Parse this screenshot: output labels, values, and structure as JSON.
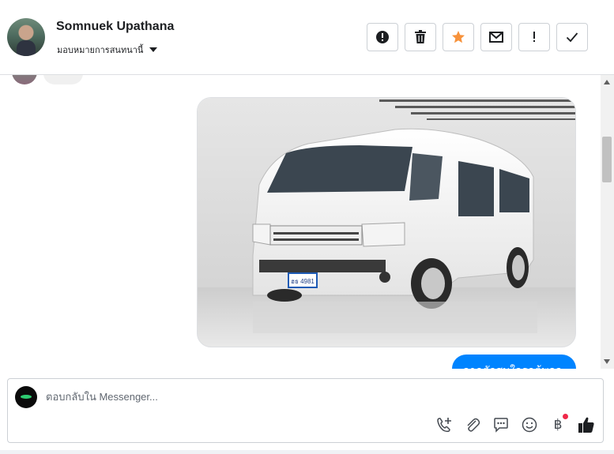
{
  "header": {
    "contact_name": "Somnuek Upathana",
    "assign_label": "มอบหมายการสนทนานี้",
    "toolbar": [
      {
        "name": "mark-spam-button",
        "icon": "alert-circle-icon"
      },
      {
        "name": "delete-button",
        "icon": "trash-icon"
      },
      {
        "name": "star-button",
        "icon": "star-icon",
        "color": "#f7923b"
      },
      {
        "name": "mark-unread-button",
        "icon": "envelope-icon"
      },
      {
        "name": "follow-up-button",
        "icon": "exclamation-icon"
      },
      {
        "name": "mark-done-button",
        "icon": "checkmark-icon"
      }
    ]
  },
  "messages": {
    "sent_image": {
      "subject": "white-toyota-van",
      "plate": "ฮธ 4981"
    },
    "sent_text": "จากตัวสมใจรถตู้พอจะ"
  },
  "composer": {
    "placeholder": "ตอบกลับใน Messenger...",
    "value": "",
    "tools": [
      "add-call-icon",
      "attachment-icon",
      "saved-replies-icon",
      "emoji-icon",
      "payment-baht-icon",
      "like-icon"
    ],
    "baht_symbol": "฿",
    "accent": "#0084ff",
    "notification_dot_color": "#f02849"
  }
}
